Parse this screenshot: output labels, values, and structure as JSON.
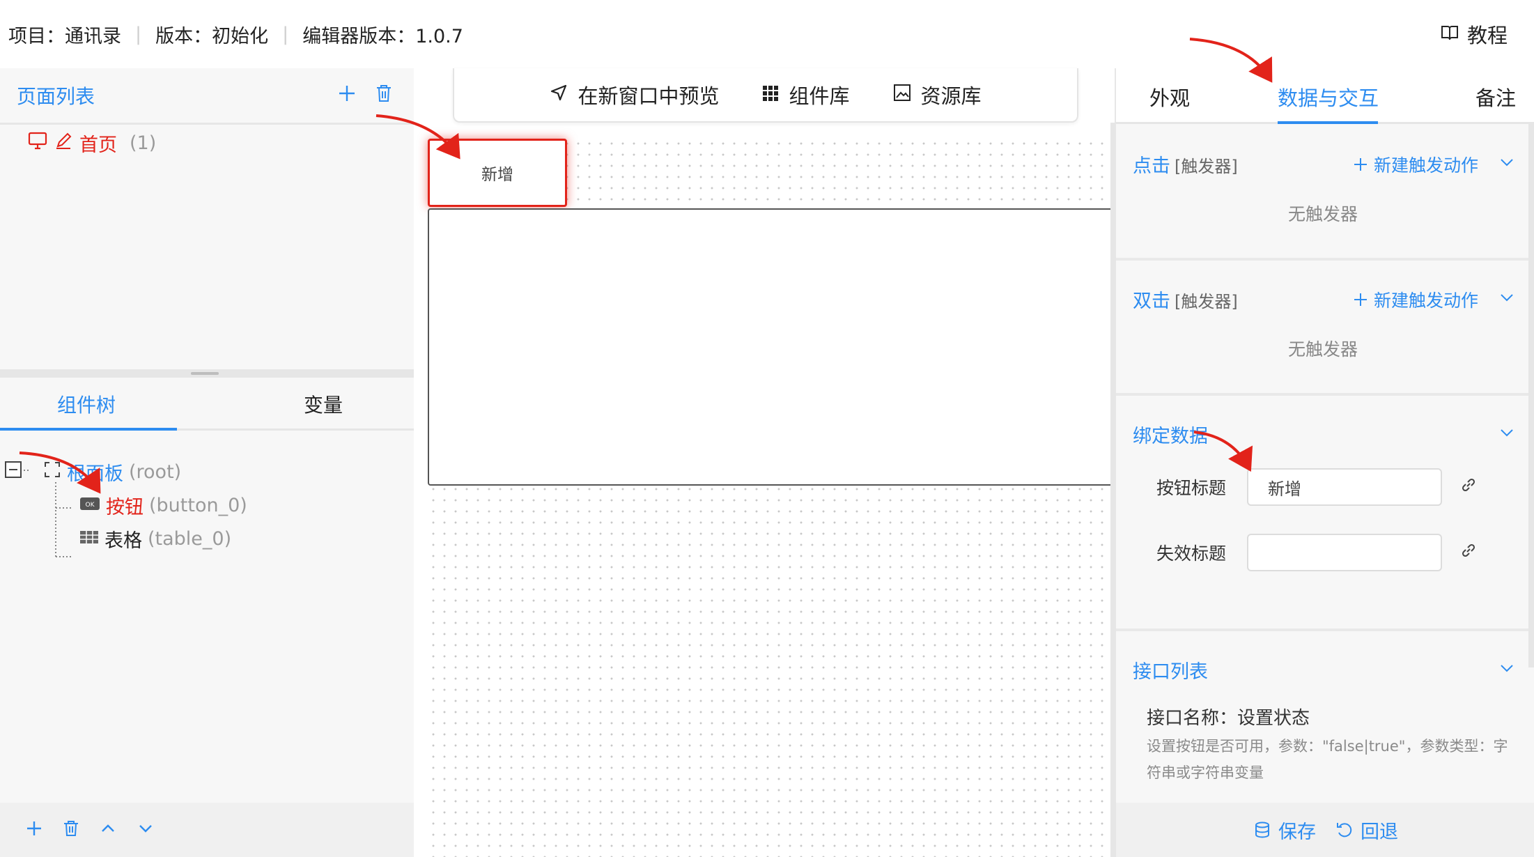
{
  "header": {
    "project_label": "项目：通讯录",
    "version_label": "版本：初始化",
    "editor_version_label": "编辑器版本：1.0.7",
    "tutorial_label": "教程"
  },
  "left_panel": {
    "page_list_title": "页面列表",
    "pages": [
      {
        "label": "首页",
        "count": "(1)"
      }
    ],
    "tabs": [
      {
        "label": "组件树",
        "active": true
      },
      {
        "label": "变量",
        "active": false
      }
    ],
    "tree": {
      "root_label": "根面板",
      "root_id": "(root)",
      "children": [
        {
          "label": "按钮",
          "id": "(button_0)",
          "icon": "ok-button-icon",
          "selected": true
        },
        {
          "label": "表格",
          "id": "(table_0)",
          "icon": "table-grid-icon",
          "selected": false
        }
      ]
    }
  },
  "toolbar": {
    "preview_label": "在新窗口中预览",
    "component_lib_label": "组件库",
    "asset_lib_label": "资源库"
  },
  "canvas": {
    "button_label": "新增"
  },
  "right_panel": {
    "tabs": [
      {
        "label": "外观",
        "active": false
      },
      {
        "label": "数据与交互",
        "active": true
      },
      {
        "label": "备注",
        "active": false
      }
    ],
    "click_section": {
      "title": "点击",
      "sub": "[触发器]",
      "action": "新建触发动作",
      "empty": "无触发器"
    },
    "dblclick_section": {
      "title": "双击",
      "sub": "[触发器]",
      "action": "新建触发动作",
      "empty": "无触发器"
    },
    "bind_section": {
      "title": "绑定数据",
      "fields": [
        {
          "label": "按钮标题",
          "value": "新增"
        },
        {
          "label": "失效标题",
          "value": ""
        }
      ]
    },
    "api_section": {
      "title": "接口列表",
      "api_name": "接口名称：设置状态",
      "api_desc": "设置按钮是否可用，参数：\"false|true\"，参数类型：字符串或字符串变量"
    },
    "footer": {
      "save_label": "保存",
      "revert_label": "回退"
    }
  },
  "colors": {
    "accent": "#2d8cf0",
    "selected": "#e2231a",
    "annotation_arrow": "#e2231a"
  }
}
